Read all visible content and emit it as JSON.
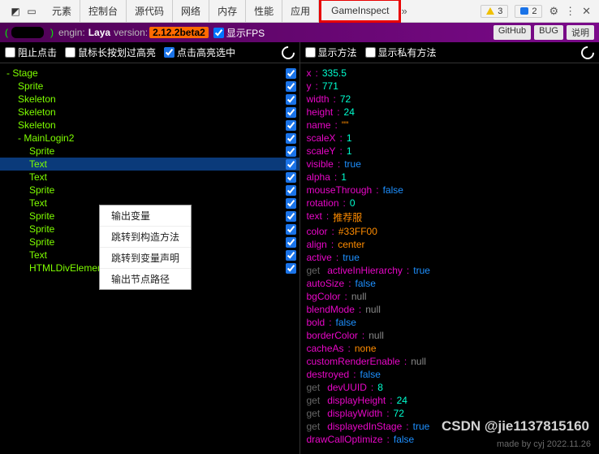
{
  "tabbar": {
    "tabs": [
      "元素",
      "控制台",
      "源代码",
      "网络",
      "内存",
      "性能",
      "应用"
    ],
    "highlighted_tab": "GameInspect",
    "warn_count": "3",
    "info_count": "2"
  },
  "engine": {
    "label": "engin:",
    "name": "Laya",
    "version_label": "version:",
    "version": "2.12.2beta2",
    "show_fps_label": "显示FPS",
    "buttons": [
      "GitHub",
      "BUG",
      "说明"
    ]
  },
  "left_opts": {
    "stop_click": "阻止点击",
    "hover_hl": "鼠标长按划过高亮",
    "click_hl": "点击高亮选中"
  },
  "right_opts": {
    "show_methods": "显示方法",
    "show_private": "显示私有方法"
  },
  "tree": [
    {
      "label": "- Stage",
      "depth": 0
    },
    {
      "label": "Sprite",
      "depth": 1
    },
    {
      "label": "Skeleton",
      "depth": 1
    },
    {
      "label": "Skeleton",
      "depth": 1
    },
    {
      "label": "Skeleton",
      "depth": 1
    },
    {
      "label": "- MainLogin2",
      "depth": 1
    },
    {
      "label": "Sprite",
      "depth": 2
    },
    {
      "label": "Text",
      "depth": 2,
      "selected": true
    },
    {
      "label": "Text",
      "depth": 2
    },
    {
      "label": "Sprite",
      "depth": 2
    },
    {
      "label": "Text",
      "depth": 2
    },
    {
      "label": "Sprite",
      "depth": 2
    },
    {
      "label": "Sprite",
      "depth": 2
    },
    {
      "label": "Sprite",
      "depth": 2
    },
    {
      "label": "Text",
      "depth": 2
    },
    {
      "label": "HTMLDivElement",
      "depth": 2
    }
  ],
  "context_menu": [
    "输出变量",
    "跳转到构造方法",
    "跳转到变量声明",
    "输出节点路径"
  ],
  "props": [
    {
      "k": "x",
      "v": "335.5",
      "t": "num"
    },
    {
      "k": "y",
      "v": "771",
      "t": "num"
    },
    {
      "k": "width",
      "v": "72",
      "t": "num"
    },
    {
      "k": "height",
      "v": "24",
      "t": "num"
    },
    {
      "k": "name",
      "v": "\"\"",
      "t": "str"
    },
    {
      "k": "scaleX",
      "v": "1",
      "t": "num"
    },
    {
      "k": "scaleY",
      "v": "1",
      "t": "num"
    },
    {
      "k": "visible",
      "v": "true",
      "t": "true"
    },
    {
      "k": "alpha",
      "v": "1",
      "t": "num"
    },
    {
      "k": "mouseThrough",
      "v": "false",
      "t": "false"
    },
    {
      "k": "rotation",
      "v": "0",
      "t": "num"
    },
    {
      "k": "text",
      "v": "推荐服",
      "t": "str"
    },
    {
      "k": "color",
      "v": "#33FF00",
      "t": "str"
    },
    {
      "k": "align",
      "v": "center",
      "t": "str"
    },
    {
      "k": "active",
      "v": "true",
      "t": "true"
    },
    {
      "k": "activeInHierarchy",
      "v": "true",
      "t": "true",
      "get": true
    },
    {
      "k": "autoSize",
      "v": "false",
      "t": "false"
    },
    {
      "k": "bgColor",
      "v": "null",
      "t": "null"
    },
    {
      "k": "blendMode",
      "v": "null",
      "t": "null"
    },
    {
      "k": "bold",
      "v": "false",
      "t": "false"
    },
    {
      "k": "borderColor",
      "v": "null",
      "t": "null"
    },
    {
      "k": "cacheAs",
      "v": "none",
      "t": "str"
    },
    {
      "k": "customRenderEnable",
      "v": "null",
      "t": "null"
    },
    {
      "k": "destroyed",
      "v": "false",
      "t": "false"
    },
    {
      "k": "devUUID",
      "v": "8",
      "t": "num",
      "get": true
    },
    {
      "k": "displayHeight",
      "v": "24",
      "t": "num",
      "get": true
    },
    {
      "k": "displayWidth",
      "v": "72",
      "t": "num",
      "get": true
    },
    {
      "k": "displayedInStage",
      "v": "true",
      "t": "true",
      "get": true
    },
    {
      "k": "drawCallOptimize",
      "v": "false",
      "t": "false"
    }
  ],
  "watermark1": "CSDN @jie1137815160",
  "watermark2": "made by cyj 2022.11.26"
}
